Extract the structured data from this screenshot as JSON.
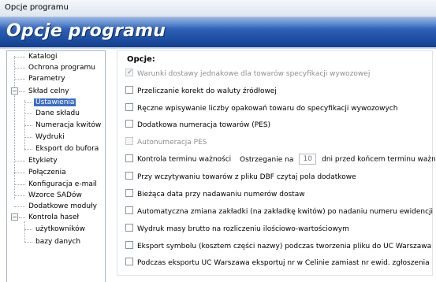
{
  "window": {
    "title": "Opcje programu"
  },
  "banner": {
    "title": "Opcje programu"
  },
  "tree": {
    "items": [
      {
        "label": "Katalogi"
      },
      {
        "label": "Ochrona programu"
      },
      {
        "label": "Parametry"
      },
      {
        "label": "Skład celny",
        "expanded": true
      },
      {
        "label": "Ustawienia",
        "selected": true
      },
      {
        "label": "Dane składu"
      },
      {
        "label": "Numeracja kwitów"
      },
      {
        "label": "Wydruki"
      },
      {
        "label": "Eksport do bufora"
      },
      {
        "label": "Etykiety"
      },
      {
        "label": "Połączenia"
      },
      {
        "label": "Konfiguracja e-mail"
      },
      {
        "label": "Wzorce SADów"
      },
      {
        "label": "Dodatkowe moduły"
      },
      {
        "label": "Kontrola haseł",
        "expanded": true
      },
      {
        "label": "użytkowników"
      },
      {
        "label": "bazy danych"
      }
    ]
  },
  "options": {
    "header": "Opcje:",
    "items": [
      {
        "label": "Warunki dostawy jednakowe dla towarów specyfikacji  wywozowej",
        "checked": true,
        "disabled": true
      },
      {
        "label": "Przeliczanie korekt do waluty źródłowej",
        "checked": false,
        "disabled": false
      },
      {
        "label": "Ręczne wpisywanie liczby opakowań towaru do specyfikacji wywozowych",
        "checked": false,
        "disabled": false
      },
      {
        "label": "Dodatkowa numeracja towarów (PES)",
        "checked": false,
        "disabled": false
      },
      {
        "label": "Autonumeracja PES",
        "checked": false,
        "disabled": true
      },
      {
        "label": "Kontrola terminu ważności",
        "checked": false,
        "disabled": false
      },
      {
        "label": "Przy wczytywaniu towarów z pliku DBF czytaj pola dodatkowe",
        "checked": false,
        "disabled": false
      },
      {
        "label": "Bieżąca data przy nadawaniu numerów dostaw",
        "checked": false,
        "disabled": false
      },
      {
        "label": "Automatyczna zmiana zakładki (na zakładkę kwitów) po nadaniu numeru ewidencji",
        "checked": false,
        "disabled": false
      },
      {
        "label": "Wydruk masy brutto na rozliczeniu ilościowo-wartościowym",
        "checked": false,
        "disabled": false
      },
      {
        "label": "Eksport symbolu (kosztem części nazwy) podczas tworzenia pliku do UC Warszawa",
        "checked": false,
        "disabled": false
      },
      {
        "label": "Podczas eksportu UC Warszawa eksportuj nr w Celinie zamiast nr  ewid. zgłoszenia",
        "checked": false,
        "disabled": false
      }
    ],
    "expiry": {
      "warn_before": "Ostrzeganie na",
      "days": "10",
      "warn_after": "dni przed końcem terminu ważności"
    }
  },
  "colors": {
    "banner": "#2a5db3",
    "selection": "#3a6cc6"
  }
}
